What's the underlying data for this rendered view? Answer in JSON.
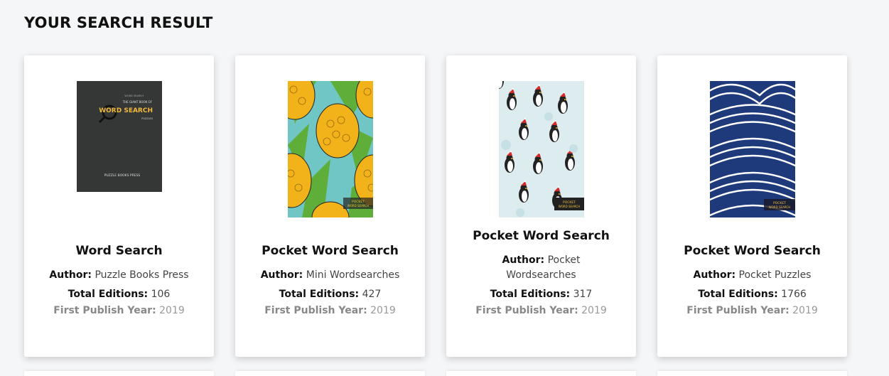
{
  "page": {
    "heading": "YOUR SEARCH RESULT"
  },
  "labels": {
    "author": "Author:",
    "editions": "Total Editions:",
    "year": "First Publish Year:"
  },
  "results": [
    {
      "title": "Word Search",
      "author": "Puzzle Books Press",
      "editions": "106",
      "year": "2019",
      "cover": {
        "style": "dark-word-search",
        "small_title": "THE GIANT BOOK OF",
        "big_title": "WORD SEARCH",
        "sub": "PUZZLES",
        "publisher": "PUZZLE BOOKS PRESS"
      }
    },
    {
      "title": "Pocket Word Search",
      "author": "Mini Wordsearches",
      "editions": "427",
      "year": "2019",
      "cover": {
        "style": "pineapple-pattern",
        "tag_top": "POCKET",
        "tag_bottom": "WORD SEARCH"
      }
    },
    {
      "title": "Pocket Word Search",
      "author": "Pocket Wordsearches",
      "editions": "317",
      "year": "2019",
      "cover": {
        "style": "penguin-pattern",
        "tag_top": "POCKET",
        "tag_bottom": "WORD SEARCH"
      }
    },
    {
      "title": "Pocket Word Search",
      "author": "Pocket Puzzles",
      "editions": "1766",
      "year": "2019",
      "cover": {
        "style": "blue-wave-pattern",
        "tag_top": "POCKET",
        "tag_bottom": "WORD SEARCH"
      }
    }
  ]
}
